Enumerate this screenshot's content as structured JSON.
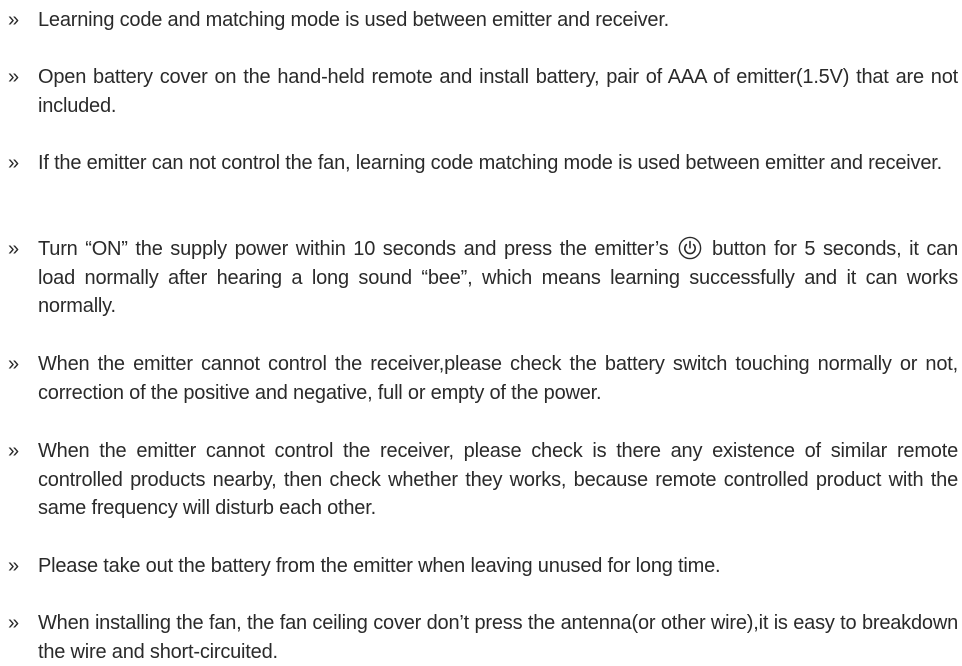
{
  "bullet_glyph": "»",
  "instructions": [
    {
      "text": "Learning code and matching mode is used between emitter and receiver."
    },
    {
      "text": "Open battery cover on the hand-held remote and install battery, pair of AAA of emitter(1.5V) that are not included."
    },
    {
      "text": "If the emitter can not control the fan, learning code matching mode is used between emitter and receiver."
    },
    {
      "text_before_icon": "Turn “ON” the supply power within 10 seconds and press the emitter’s",
      "icon": "power-icon",
      "text_after_icon": "button for 5 seconds, it can load normally after hearing a long sound “bee”, which means learning successfully and it can works normally."
    },
    {
      "text": "When the emitter cannot control the receiver,please check the battery switch touching normally or not, correction of the positive and negative, full or empty of the power."
    },
    {
      "text": "When the emitter cannot control the receiver, please check is there any existence of similar remote controlled products nearby, then check whether they works, because remote controlled product with the same frequency will disturb each other."
    },
    {
      "text": "Please take out the battery from the emitter when leaving unused for long time."
    },
    {
      "text": "When installing the fan, the fan ceiling cover don’t press the antenna(or other wire),it is easy to breakdown the wire and short-circuited."
    }
  ]
}
